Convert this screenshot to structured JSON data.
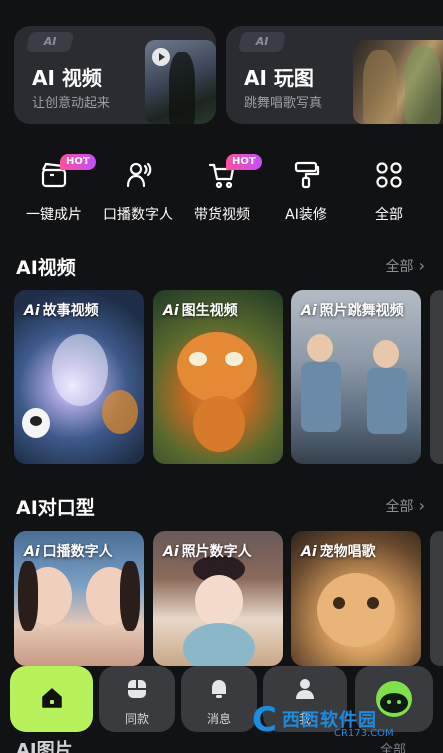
{
  "feature_cards": [
    {
      "tag": "AI",
      "title": "AI 视频",
      "subtitle": "让创意动起来"
    },
    {
      "tag": "AI",
      "title": "AI 玩图",
      "subtitle": "跳舞唱歌写真"
    }
  ],
  "tools": [
    {
      "label": "一键成片",
      "icon": "clapperboard-icon",
      "badge": "HOT"
    },
    {
      "label": "口播数字人",
      "icon": "avatar-speak-icon",
      "badge": ""
    },
    {
      "label": "带货视频",
      "icon": "shopping-cart-icon",
      "badge": "HOT"
    },
    {
      "label": "AI装修",
      "icon": "paint-roller-icon",
      "badge": ""
    },
    {
      "label": "全部",
      "icon": "grid-dots-icon",
      "badge": ""
    }
  ],
  "sections": {
    "ai_video": {
      "title": "AI视频",
      "more": "全部",
      "cards": [
        {
          "badge": "Ai",
          "label": "故事视频"
        },
        {
          "badge": "Ai",
          "label": "图生视频"
        },
        {
          "badge": "Ai",
          "label": "照片跳舞视频"
        }
      ]
    },
    "ai_lipsync": {
      "title": "AI对口型",
      "more": "全部",
      "cards": [
        {
          "badge": "Ai",
          "label": "口播数字人"
        },
        {
          "badge": "Ai",
          "label": "照片数字人"
        },
        {
          "badge": "Ai",
          "label": "宠物唱歌"
        }
      ]
    },
    "ai_image": {
      "title": "AI图片",
      "more": "全部"
    }
  },
  "bottom_nav": [
    {
      "label": "",
      "icon": "home-icon"
    },
    {
      "label": "同款",
      "icon": "template-icon"
    },
    {
      "label": "消息",
      "icon": "bell-icon"
    },
    {
      "label": "我",
      "icon": "user-icon"
    },
    {
      "label": "",
      "icon": "ai-orb-icon"
    }
  ],
  "watermark": {
    "name": "西西软件园",
    "url": "CR173.COM"
  },
  "colors": {
    "accent": "#b8f25a",
    "background": "#111214",
    "card": "#2a2c31",
    "hot_badge": "#ff4f9a"
  }
}
